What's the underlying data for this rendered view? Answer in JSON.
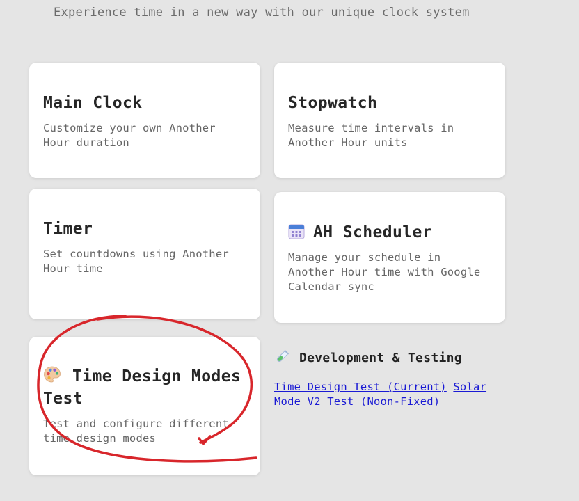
{
  "header": {
    "subtitle": "Experience time in a new way with our unique clock system"
  },
  "cards": {
    "main_clock": {
      "title": "Main Clock",
      "description": "Customize your own Another Hour duration"
    },
    "stopwatch": {
      "title": "Stopwatch",
      "description": "Measure time intervals in Another Hour units"
    },
    "timer": {
      "title": "Timer",
      "description": "Set countdowns using Another Hour time"
    },
    "scheduler": {
      "icon": "calendar-icon",
      "title": "AH Scheduler",
      "description": "Manage your schedule in Another Hour time with Google Calendar sync"
    },
    "time_design": {
      "icon": "palette-icon",
      "title": "Time Design Modes Test",
      "description": "Test and configure different time design modes"
    }
  },
  "dev": {
    "icon": "test-tube-icon",
    "heading": "Development & Testing",
    "links": [
      "Time Design Test (Current)",
      "Solar Mode V2 Test (Noon-Fixed)"
    ]
  },
  "annotation": {
    "color": "#d8262b"
  }
}
